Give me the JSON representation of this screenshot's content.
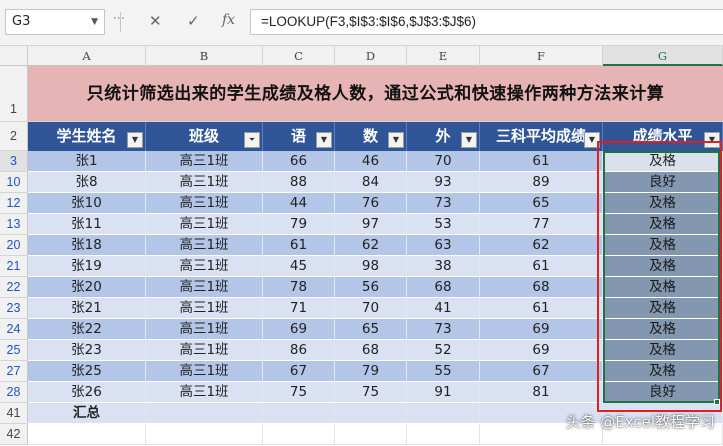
{
  "formula_bar": {
    "name_box": "G3",
    "formula": "=LOOKUP(F3,$I$3:$I$6,$J$3:$J$6)",
    "cancel_glyph": "✕",
    "enter_glyph": "✓",
    "fx_label": "fx"
  },
  "columns": [
    "A",
    "B",
    "C",
    "D",
    "E",
    "F",
    "G"
  ],
  "selected_column": "G",
  "title": "只统计筛选出来的学生成绩及格人数，通过公式和快速操作两种方法来计算",
  "title_row_number": "1",
  "header_row_number": "2",
  "headers": [
    "学生姓名",
    "班级",
    "语",
    "数",
    "外",
    "三科平均成绩",
    "成绩水平"
  ],
  "rows": [
    {
      "num": "3",
      "name": "张1",
      "class": "高三1班",
      "yu": "66",
      "shu": "46",
      "wai": "70",
      "avg": "61",
      "level": "及格"
    },
    {
      "num": "10",
      "name": "张8",
      "class": "高三1班",
      "yu": "88",
      "shu": "84",
      "wai": "93",
      "avg": "89",
      "level": "良好"
    },
    {
      "num": "12",
      "name": "张10",
      "class": "高三1班",
      "yu": "44",
      "shu": "76",
      "wai": "73",
      "avg": "65",
      "level": "及格"
    },
    {
      "num": "13",
      "name": "张11",
      "class": "高三1班",
      "yu": "79",
      "shu": "97",
      "wai": "53",
      "avg": "77",
      "level": "及格"
    },
    {
      "num": "20",
      "name": "张18",
      "class": "高三1班",
      "yu": "61",
      "shu": "62",
      "wai": "63",
      "avg": "62",
      "level": "及格"
    },
    {
      "num": "21",
      "name": "张19",
      "class": "高三1班",
      "yu": "45",
      "shu": "98",
      "wai": "38",
      "avg": "61",
      "level": "及格"
    },
    {
      "num": "22",
      "name": "张20",
      "class": "高三1班",
      "yu": "78",
      "shu": "56",
      "wai": "68",
      "avg": "68",
      "level": "及格"
    },
    {
      "num": "23",
      "name": "张21",
      "class": "高三1班",
      "yu": "71",
      "shu": "70",
      "wai": "41",
      "avg": "61",
      "level": "及格"
    },
    {
      "num": "24",
      "name": "张22",
      "class": "高三1班",
      "yu": "69",
      "shu": "65",
      "wai": "73",
      "avg": "69",
      "level": "及格"
    },
    {
      "num": "25",
      "name": "张23",
      "class": "高三1班",
      "yu": "86",
      "shu": "68",
      "wai": "52",
      "avg": "69",
      "level": "及格"
    },
    {
      "num": "27",
      "name": "张25",
      "class": "高三1班",
      "yu": "67",
      "shu": "79",
      "wai": "55",
      "avg": "67",
      "level": "及格"
    },
    {
      "num": "28",
      "name": "张26",
      "class": "高三1班",
      "yu": "75",
      "shu": "75",
      "wai": "91",
      "avg": "81",
      "level": "良好"
    }
  ],
  "summary_row": {
    "num": "41",
    "label": "汇总"
  },
  "last_row_number": "42",
  "watermark": "头条 @Excel教程学习",
  "colors": {
    "header_fill": "#2f5597",
    "title_fill": "#e6b4b4",
    "band_light": "#d9e1f2",
    "band_dark": "#b4c6e7",
    "selection_fill": "#8497b0",
    "selection_border": "#217346",
    "annotation_border": "#e02020"
  }
}
